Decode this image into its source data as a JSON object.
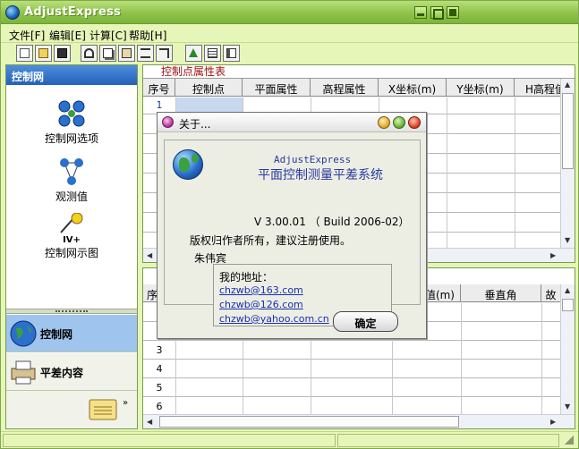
{
  "window": {
    "title": "AdjustExpress"
  },
  "menu": [
    {
      "label": "文件[F]"
    },
    {
      "label": "编辑[E]"
    },
    {
      "label": "计算[C]"
    },
    {
      "label": "帮助[H]"
    }
  ],
  "toolbar": {
    "icons": [
      "new-file-icon",
      "open-folder-icon",
      "save-icon",
      "cut-icon",
      "copy-icon",
      "paste-icon",
      "insert-row-icon",
      "delete-row-icon",
      "compute-icon",
      "calculator-icon",
      "report-icon"
    ]
  },
  "sidebar": {
    "header": "控制网",
    "items": [
      {
        "label": "控制网选项"
      },
      {
        "label": "观测值"
      },
      {
        "label": "控制网示图",
        "badge": "IV+"
      }
    ],
    "nav": [
      {
        "label": "控制网"
      },
      {
        "label": "平差内容"
      }
    ]
  },
  "top_grid": {
    "caption": "控制点属性表",
    "columns": [
      "序号",
      "控制点",
      "平面属性",
      "高程属性",
      "X坐标(m)",
      "Y坐标(m)",
      "H高程值"
    ],
    "rows": [
      "1"
    ]
  },
  "bottom_grid": {
    "columns": [
      "序",
      "",
      "",
      "",
      "值(m)",
      "垂直角",
      "故"
    ],
    "rows": [
      "3",
      "4",
      "5",
      "6"
    ]
  },
  "dialog": {
    "title": "关于...",
    "app_en": "AdjustExpress",
    "app_cn": "平面控制测量平差系统",
    "version": "V 3.00.01 （ Build 2006-02）",
    "rights": "版权归作者所有，建议注册使用。",
    "author": "朱伟宾",
    "address_label": "我的地址：",
    "emails": [
      "chzwb@163.com",
      "chzwb@126.com",
      "chzwb@yahoo.com.cn"
    ],
    "ok": "确定"
  }
}
